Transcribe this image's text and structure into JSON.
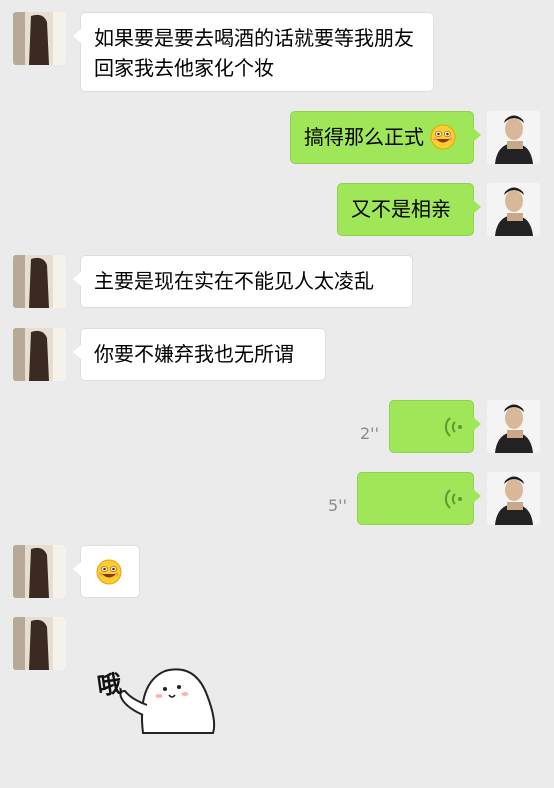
{
  "messages": [
    {
      "side": "in",
      "text": "如果要是要去喝酒的话就要等我朋友回家我去他家化个妆"
    },
    {
      "side": "out",
      "text": "搞得那么正式",
      "emoji": "grinning-emoji"
    },
    {
      "side": "out",
      "text": "又不是相亲"
    },
    {
      "side": "in",
      "text": "主要是现在实在不能见人太凌乱"
    },
    {
      "side": "in",
      "text": "你要不嫌弃我也无所谓"
    },
    {
      "side": "out",
      "type": "voice",
      "duration": "2''"
    },
    {
      "side": "out",
      "type": "voice",
      "duration": "5''"
    },
    {
      "side": "in",
      "type": "emoji",
      "emoji": "grinning-emoji"
    },
    {
      "side": "in",
      "type": "sticker",
      "sticker_text": "哦"
    }
  ],
  "colors": {
    "background": "#ebebeb",
    "incoming_bubble": "#ffffff",
    "outgoing_bubble": "#9fe658",
    "voice_wave": "#5a9a34"
  }
}
